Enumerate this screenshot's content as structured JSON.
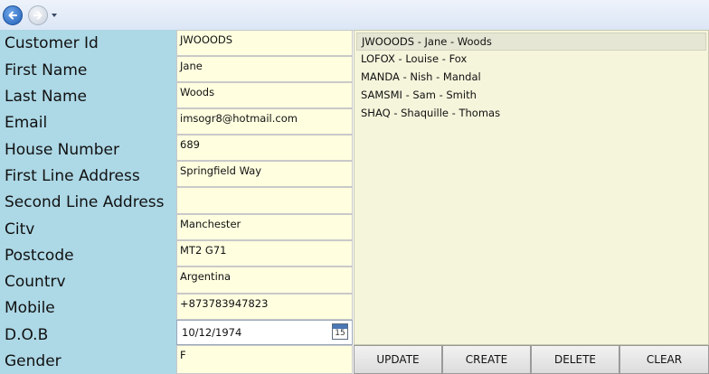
{
  "toolbar": {
    "back_icon": "back-arrow-icon",
    "forward_icon": "forward-arrow-icon",
    "dropdown_icon": "chevron-down-icon"
  },
  "form": {
    "labels": {
      "customer_id": "Customer Id",
      "first_name": "First Name",
      "last_name": "Last Name",
      "email": "Email",
      "house_number": "House Number",
      "first_line_address": "First Line Address",
      "second_line_address": "Second Line Address",
      "city": "Citv",
      "postcode": "Postcode",
      "country": "Countrv",
      "mobile": "Mobile",
      "dob": "D.O.B",
      "gender": "Gender"
    },
    "values": {
      "customer_id": "JWOOODS",
      "first_name": "Jane",
      "last_name": "Woods",
      "email": "imsogr8@hotmail.com",
      "house_number": "689",
      "first_line_address": "Springfield Way",
      "second_line_address": "",
      "city": "Manchester",
      "postcode": "MT2 G71",
      "country": "Argentina",
      "mobile": "+873783947823",
      "dob": "10/12/1974",
      "gender": "F"
    },
    "calendar_icon_day": "15"
  },
  "customer_list": {
    "items": [
      "JWOOODS - Jane - Woods",
      "LOFOX - Louise - Fox",
      "MANDA - Nish - Mandal",
      "SAMSMI - Sam - Smith",
      "SHAQ - Shaquille - Thomas"
    ],
    "selected_index": 0
  },
  "buttons": {
    "update": "UPDATE",
    "create": "CREATE",
    "delete": "DELETE",
    "clear": "CLEAR"
  },
  "colors": {
    "label_panel": "#add8e6",
    "field_background": "#ffffe0",
    "list_background": "#f5f5dc"
  }
}
